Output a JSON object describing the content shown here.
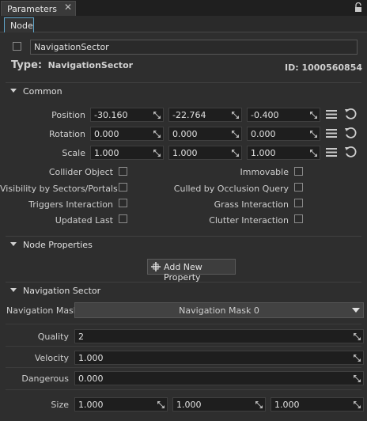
{
  "window": {
    "tab_title": "Parameters",
    "close_glyph": "✕"
  },
  "subtab": {
    "label": "Node"
  },
  "node": {
    "name": "NavigationSector",
    "enabled": false
  },
  "type_row": {
    "type_label": "Type:",
    "type_value": "NavigationSector",
    "id_label": "ID:",
    "id_value": "1000560854"
  },
  "common": {
    "title": "Common",
    "rows": [
      {
        "label": "Position",
        "values": [
          "-30.160",
          "-22.764",
          "-0.400"
        ]
      },
      {
        "label": "Rotation",
        "values": [
          "0.000",
          "0.000",
          "0.000"
        ]
      },
      {
        "label": "Scale",
        "values": [
          "1.000",
          "1.000",
          "1.000"
        ]
      }
    ],
    "flags_left": [
      {
        "label": "Collider Object",
        "checked": false
      },
      {
        "label": "Visibility by Sectors/Portals",
        "checked": false
      },
      {
        "label": "Triggers Interaction",
        "checked": false
      },
      {
        "label": "Updated Last",
        "checked": false
      }
    ],
    "flags_right": [
      {
        "label": "Immovable",
        "checked": false
      },
      {
        "label": "Culled by Occlusion Query",
        "checked": false
      },
      {
        "label": "Grass Interaction",
        "checked": false
      },
      {
        "label": "Clutter Interaction",
        "checked": false
      }
    ]
  },
  "node_properties": {
    "title": "Node Properties",
    "add_button": "Add New Property"
  },
  "navigation_sector": {
    "title": "Navigation Sector",
    "mask_label": "Navigation Mask",
    "mask_value": "Navigation Mask 0",
    "quality_label": "Quality",
    "quality_value": "2",
    "velocity_label": "Velocity",
    "velocity_value": "1.000",
    "dangerous_label": "Dangerous",
    "dangerous_value": "0.000",
    "size_label": "Size",
    "size_values": [
      "1.000",
      "1.000",
      "1.000"
    ]
  },
  "colors": {
    "accent": "#5fa4c9",
    "background": "#2e2e2e",
    "field": "#1e1e1e"
  }
}
